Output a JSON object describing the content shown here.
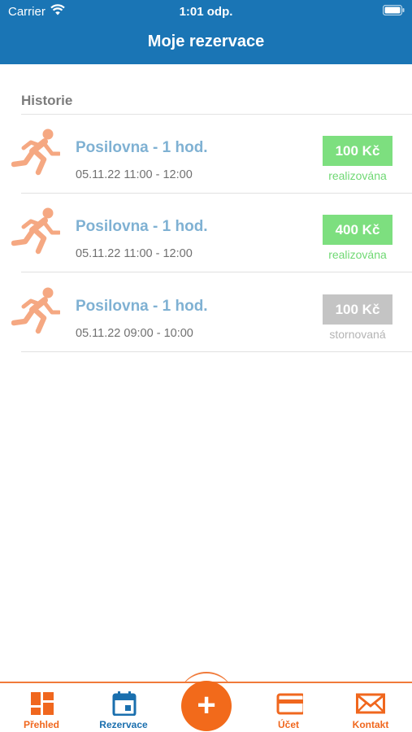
{
  "status_bar": {
    "carrier": "Carrier",
    "time": "1:01 odp."
  },
  "header": {
    "title": "Moje rezervace"
  },
  "section": {
    "title": "Historie"
  },
  "reservations": [
    {
      "title": "Posilovna - 1 hod.",
      "time": "05.11.22 11:00 - 12:00",
      "price": "100 Kč",
      "status": "realizována",
      "state": "completed"
    },
    {
      "title": "Posilovna - 1 hod.",
      "time": "05.11.22 11:00 - 12:00",
      "price": "400 Kč",
      "status": "realizována",
      "state": "completed"
    },
    {
      "title": "Posilovna - 1 hod.",
      "time": "05.11.22 09:00 - 10:00",
      "price": "100 Kč",
      "status": "stornovaná",
      "state": "cancelled"
    }
  ],
  "tabbar": {
    "items": [
      {
        "label": "Přehled",
        "icon": "dashboard-icon"
      },
      {
        "label": "Rezervace",
        "icon": "calendar-icon",
        "active": true
      },
      {
        "label": "Účet",
        "icon": "credit-card-icon"
      },
      {
        "label": "Kontakt",
        "icon": "envelope-icon"
      }
    ],
    "center_button": "+"
  },
  "colors": {
    "header": "#1a75b5",
    "accent": "#f26a1b",
    "active_tab": "#1a6fae",
    "completed": "#7ddf7f",
    "cancelled": "#c4c4c4",
    "title_link": "#7fb1d3",
    "runner": "#f5a882"
  }
}
